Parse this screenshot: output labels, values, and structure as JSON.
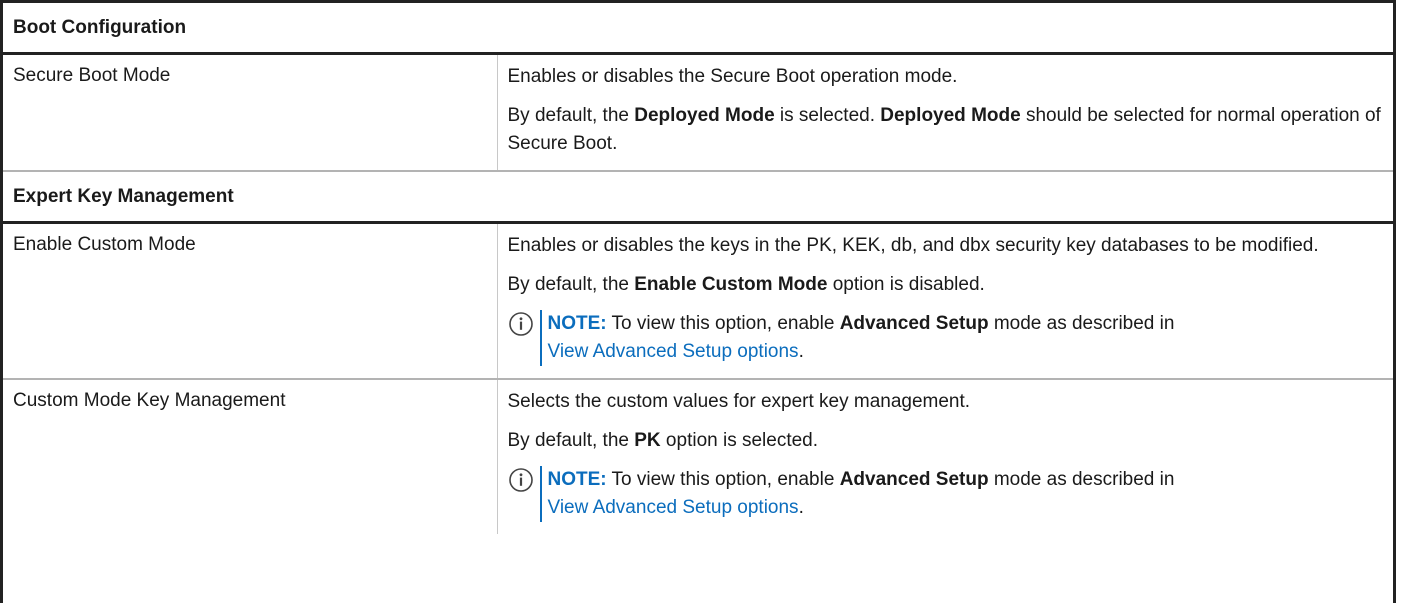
{
  "sections": [
    {
      "title": "Boot Configuration",
      "rows": [
        {
          "name": "Secure Boot Mode",
          "desc1": "Enables or disables the Secure Boot operation mode.",
          "default": {
            "pre": "By default, the ",
            "b1": "Deployed Mode",
            "mid": " is selected. ",
            "b2": "Deployed Mode",
            "post": " should be selected for normal operation of Secure Boot."
          }
        }
      ]
    },
    {
      "title": "Expert Key Management",
      "rows": [
        {
          "name": "Enable Custom Mode",
          "desc1": "Enables or disables the keys in the PK, KEK, db, and dbx security key databases to be modified.",
          "default": {
            "pre": "By default, the ",
            "b1": "Enable Custom Mode",
            "post": " option is disabled."
          },
          "note": {
            "label": "NOTE:",
            "pre": " To view this option, enable ",
            "bold": "Advanced Setup",
            "post": " mode as described in ",
            "link": "View Advanced Setup options",
            "end": "."
          }
        },
        {
          "name": "Custom Mode Key Management",
          "desc1": "Selects the custom values for expert key management.",
          "default": {
            "pre": "By default, the ",
            "b1": "PK",
            "post": " option is selected."
          },
          "note": {
            "label": "NOTE:",
            "pre": " To view this option, enable ",
            "bold": "Advanced Setup",
            "post": " mode as described in ",
            "link": "View Advanced Setup options",
            "end": "."
          }
        }
      ]
    }
  ],
  "icons": {
    "note": "info-circle-icon"
  },
  "colors": {
    "link": "#0b6dbd",
    "border": "#222222"
  }
}
